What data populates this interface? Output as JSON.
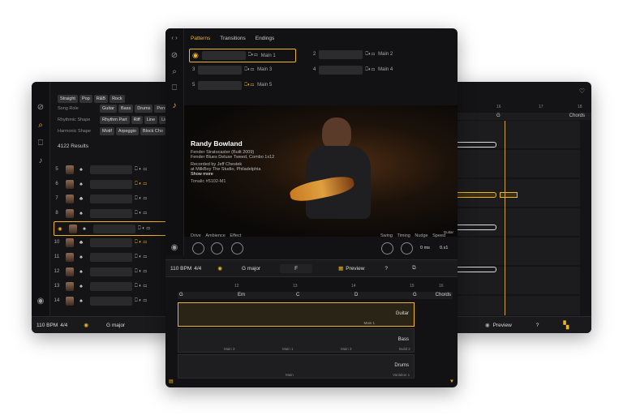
{
  "left_panel": {
    "style_chips": [
      "Straight",
      "Pop",
      "R&B",
      "Rock"
    ],
    "filters": [
      {
        "label": "Song Role",
        "chips": [
          "Guitar",
          "Bass",
          "Drums",
          "Percu"
        ]
      },
      {
        "label": "Rhythmic Shape",
        "chips": [
          "Rhythm Part",
          "Riff",
          "Line",
          "Lic"
        ]
      },
      {
        "label": "Harmonic Shape",
        "chips": [
          "Motif",
          "Arpeggio",
          "Block Cho"
        ]
      }
    ],
    "results_count": "4122 Results",
    "rows": [
      "5",
      "6",
      "7",
      "8",
      "9",
      "10",
      "11",
      "12",
      "13",
      "14"
    ],
    "bottom": {
      "bpm": "110 BPM",
      "sig": "4/4",
      "key": "G major"
    }
  },
  "main": {
    "tabs": [
      "Patterns",
      "Transitions",
      "Endings"
    ],
    "slots": [
      {
        "num": "1",
        "label": "Main 1"
      },
      {
        "num": "2",
        "label": "Main 2"
      },
      {
        "num": "3",
        "label": "Main 3"
      },
      {
        "num": "4",
        "label": "Main 4"
      },
      {
        "num": "5",
        "label": "Main 5"
      }
    ],
    "artist": {
      "name": "Randy Bowland",
      "gear1": "Fender Stratocaster (Built 2009)",
      "gear2": "Fender Blues Deluxe Tweed, Combo 1x12",
      "rec1": "Recorded by Jeff Chestek",
      "rec2": "at MilkBoy The Studio, Philadelphia",
      "show_more": "Show more",
      "tonalic": "Tonalic #5102-M1",
      "photo_tag": "Guitar"
    },
    "knobs_left": [
      "Drive",
      "Ambience",
      "Effect"
    ],
    "knobs_right": [
      "Swing",
      "Timing",
      "Nudge",
      "Speed"
    ],
    "nudge_value": "0 ms",
    "speed_value": "0.x1",
    "transport": {
      "bpm": "110 BPM",
      "sig": "4/4",
      "key": "G major",
      "chord": "F",
      "preview": "Preview",
      "help": "?"
    },
    "ruler": [
      "12",
      "13",
      "14",
      "15",
      "16"
    ],
    "chord_row": [
      "G",
      "Em",
      "C",
      "D",
      "G",
      "Chords"
    ],
    "tracks": [
      {
        "name": "Guitar",
        "sections": [
          "Main 1"
        ]
      },
      {
        "name": "Bass",
        "sections": [
          "Main 3",
          "Main 1",
          "Main 3",
          "Build 2"
        ]
      },
      {
        "name": "Drums",
        "sections": [
          "Main",
          "Variation 1"
        ]
      }
    ]
  },
  "right_panel": {
    "ruler": [
      "16",
      "17",
      "18"
    ],
    "chords": [
      "G",
      "Chords"
    ],
    "bottom": {
      "preview": "Preview",
      "help": "?"
    }
  },
  "colors": {
    "accent": "#f0b429",
    "panel": "#141416",
    "chip": "#333336"
  }
}
